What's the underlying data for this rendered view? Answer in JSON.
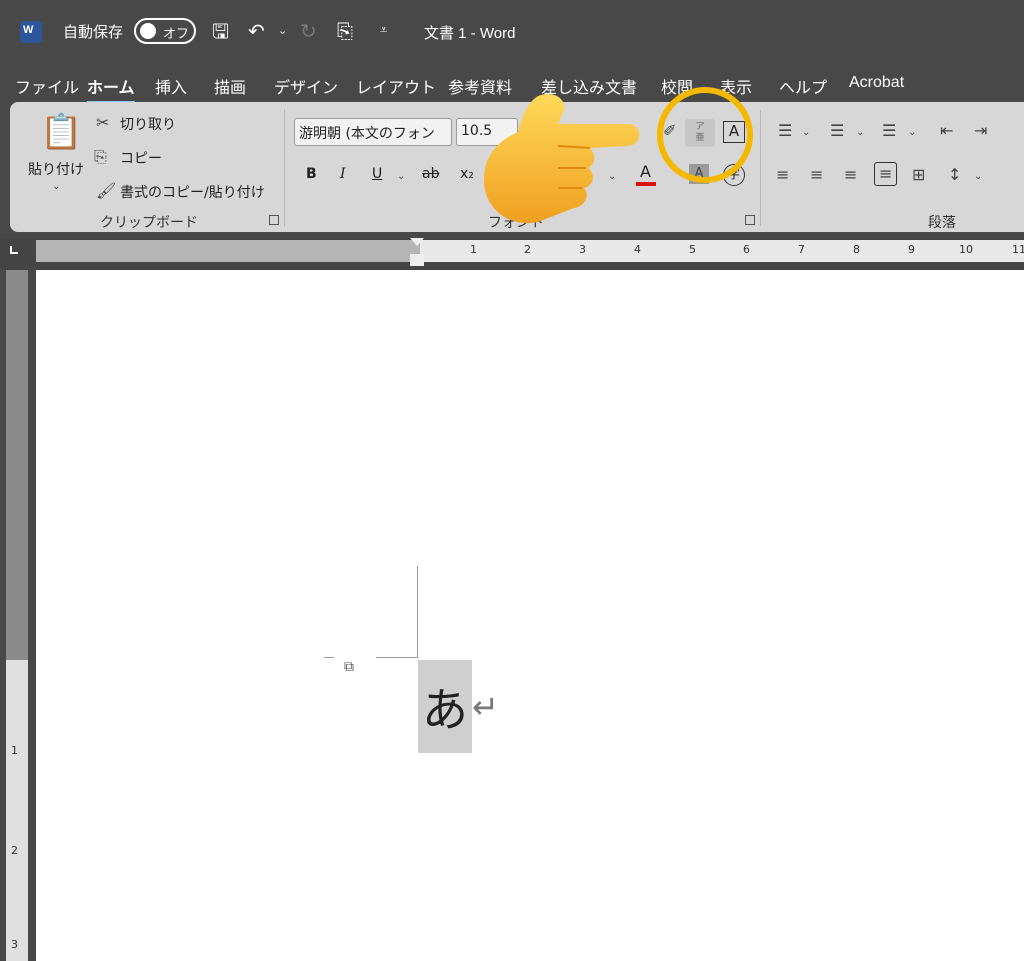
{
  "titlebar": {
    "app_icon": "word-icon",
    "app_icon_letter": "W",
    "autosave_label": "自動保存",
    "autosave_state": "オフ",
    "doc_title": "文書 1  -  Word"
  },
  "tabs": [
    {
      "label": "ファイル",
      "active": false
    },
    {
      "label": "ホーム",
      "active": true
    },
    {
      "label": "挿入",
      "active": false
    },
    {
      "label": "描画",
      "active": false
    },
    {
      "label": "デザイン",
      "active": false
    },
    {
      "label": "レイアウト",
      "active": false
    },
    {
      "label": "参考資料",
      "active": false
    },
    {
      "label": "差し込み文書",
      "active": false
    },
    {
      "label": "校閲",
      "active": false
    },
    {
      "label": "表示",
      "active": false
    },
    {
      "label": "ヘルプ",
      "active": false
    },
    {
      "label": "Acrobat",
      "active": false
    }
  ],
  "clipboard": {
    "paste": "貼り付け",
    "cut": "切り取り",
    "copy": "コピー",
    "format_painter": "書式のコピー/貼り付け",
    "group": "クリップボード"
  },
  "font": {
    "font_name": "游明朝 (本文のフォン",
    "font_size": "10.5",
    "group": "フォント",
    "bold": "B",
    "italic": "I",
    "underline": "U",
    "strike": "ab",
    "subscript": "x₂",
    "font_color": "A",
    "ruby_label": "ア\n亜",
    "char_border": "A",
    "char_shading": "A",
    "enclosed": "字",
    "font_color_hex": "#e01010"
  },
  "paragraph": {
    "group": "段落"
  },
  "ruler": {
    "numbers": [
      "1",
      "2",
      "3",
      "4",
      "5",
      "6",
      "7",
      "8",
      "9",
      "10",
      "11"
    ],
    "vertical_numbers": [
      "1",
      "2",
      "3"
    ]
  },
  "document": {
    "text": "あ",
    "paragraph_mark": "↵"
  },
  "colors": {
    "highlight_ring": "#f5b800",
    "active_tab_underline": "#8fc3ff"
  }
}
